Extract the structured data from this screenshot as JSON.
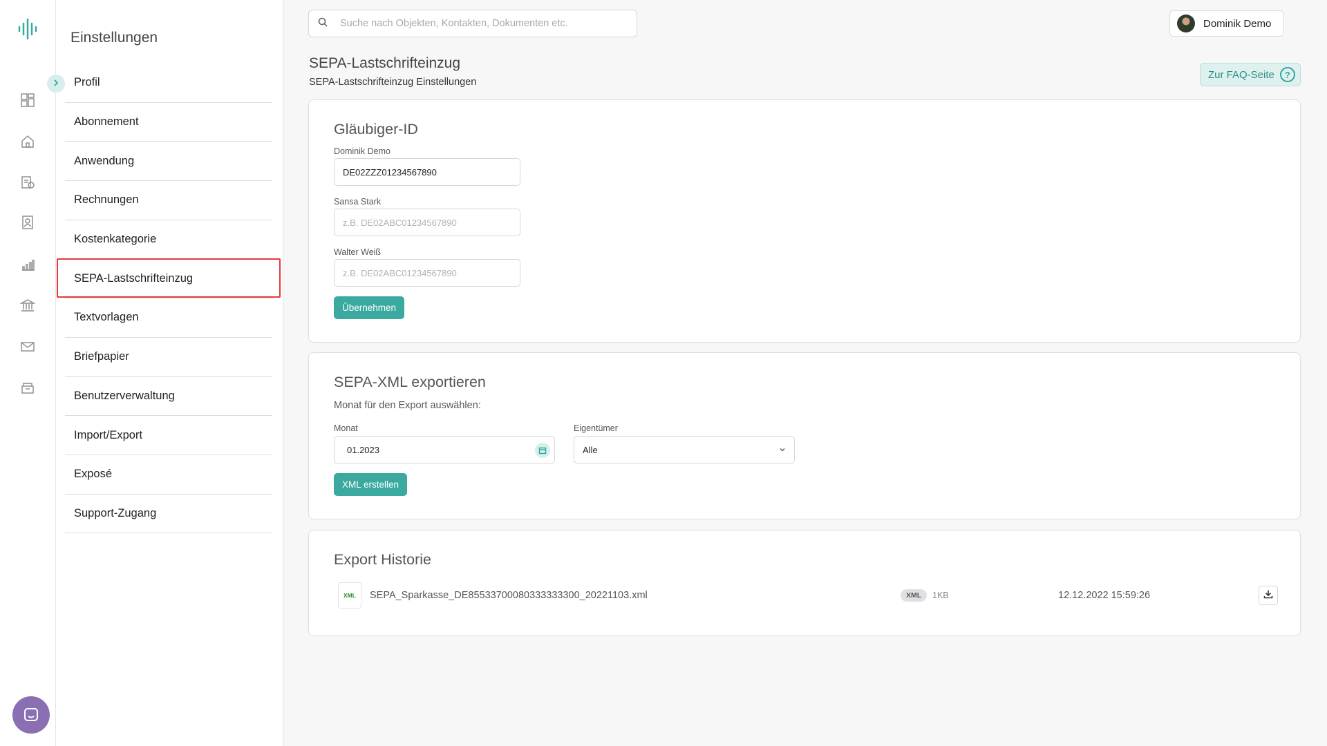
{
  "rail": {
    "icons": [
      "logo-icon",
      "dashboard-icon",
      "home-icon",
      "billing-icon",
      "contacts-icon",
      "chart-icon",
      "bank-icon",
      "mail-icon",
      "archive-icon",
      "chat-icon"
    ]
  },
  "settings": {
    "title": "Einstellungen",
    "items": [
      {
        "label": "Profil"
      },
      {
        "label": "Abonnement"
      },
      {
        "label": "Anwendung"
      },
      {
        "label": "Rechnungen"
      },
      {
        "label": "Kostenkategorie"
      },
      {
        "label": "SEPA-Lastschrifteinzug"
      },
      {
        "label": "Textvorlagen"
      },
      {
        "label": "Briefpapier"
      },
      {
        "label": "Benutzerverwaltung"
      },
      {
        "label": "Import/Export"
      },
      {
        "label": "Exposé"
      },
      {
        "label": "Support-Zugang"
      }
    ]
  },
  "header": {
    "search_placeholder": "Suche nach Objekten, Kontakten, Dokumenten etc.",
    "user_name": "Dominik Demo"
  },
  "page": {
    "title": "SEPA-Lastschrifteinzug",
    "subtitle": "SEPA-Lastschrifteinzug Einstellungen",
    "faq_label": "Zur FAQ-Seite"
  },
  "creditor": {
    "title": "Gläubiger-ID",
    "fields": [
      {
        "label": "Dominik Demo",
        "value": "DE02ZZZ01234567890",
        "placeholder": ""
      },
      {
        "label": "Sansa Stark",
        "value": "",
        "placeholder": "z.B. DE02ABC01234567890"
      },
      {
        "label": "Walter Weiß",
        "value": "",
        "placeholder": "z.B. DE02ABC01234567890"
      }
    ],
    "apply_label": "Übernehmen"
  },
  "export": {
    "title": "SEPA-XML exportieren",
    "help": "Monat für den Export auswählen:",
    "month_label": "Monat",
    "month_value": "01.2023",
    "owner_label": "Eigentümer",
    "owner_value": "Alle",
    "create_label": "XML erstellen"
  },
  "history": {
    "title": "Export Historie",
    "rows": [
      {
        "icon_text": "XML",
        "file": "SEPA_Sparkasse_DE85533700080333333300_20221103.xml",
        "badge": "XML",
        "size": "1KB",
        "date": "12.12.2022 15:59:26"
      }
    ]
  },
  "colors": {
    "accent": "#3aa99f",
    "highlight": "#e23b3b",
    "chat": "#8a6fb3"
  }
}
